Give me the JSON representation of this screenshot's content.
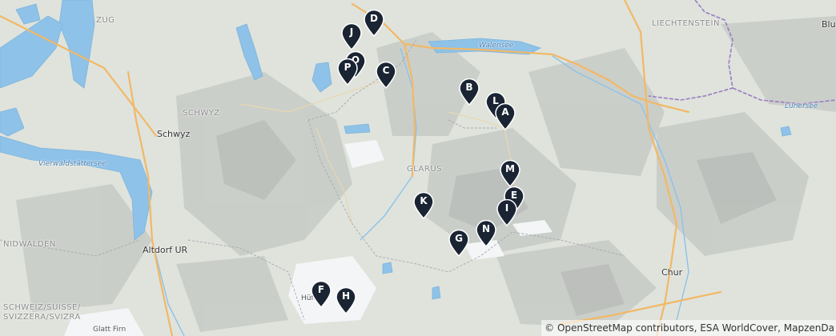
{
  "colors": {
    "land": "#dfe3dc",
    "mountain": "#c4c7c4",
    "glacier": "#f4f6f8",
    "water": "#8ec2e8",
    "road": "#f2b866",
    "border": "#9a7bc4",
    "marker": "#1a2433"
  },
  "map": {
    "labels": {
      "zug": "ZUG",
      "liechtenstein": "LIECHTENSTEIN",
      "blu": "Blu",
      "walensee": "Walensee",
      "schwyz_region": "SCHWYZ",
      "schwyz": "Schwyz",
      "vierwaldstaettersee": "Vierwaldstättersee",
      "glarus": "GLARUS",
      "luenersee": "Lünersee",
      "nidwalden": "NIDWALDEN",
      "altdorf": "Altdorf UR",
      "chur": "Chur",
      "huefifirn": "Hüfifirn",
      "switzerland_1": "SCHWEIZ/SUISSE/",
      "switzerland_2": "SVIZZERA/SVIZRA",
      "glatt_firn": "Glatt Firn"
    },
    "markers": [
      {
        "id": "D"
      },
      {
        "id": "J"
      },
      {
        "id": "O"
      },
      {
        "id": "P"
      },
      {
        "id": "C"
      },
      {
        "id": "B"
      },
      {
        "id": "L"
      },
      {
        "id": "A"
      },
      {
        "id": "M"
      },
      {
        "id": "E"
      },
      {
        "id": "I"
      },
      {
        "id": "K"
      },
      {
        "id": "N"
      },
      {
        "id": "G"
      },
      {
        "id": "F"
      },
      {
        "id": "H"
      }
    ]
  },
  "attribution": "© OpenStreetMap contributors, ESA WorldCover, MapzenDa"
}
